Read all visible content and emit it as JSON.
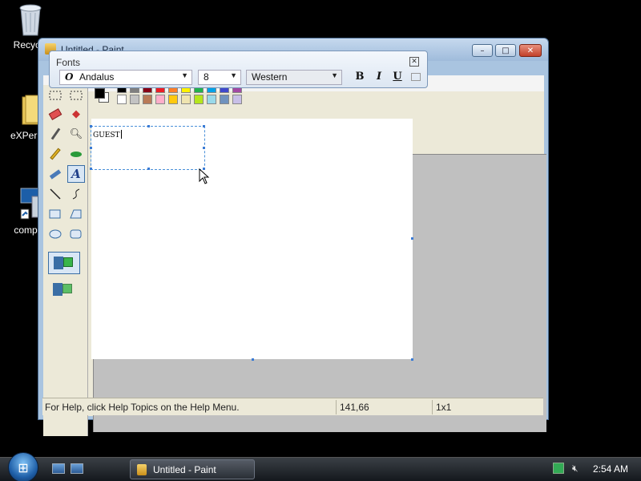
{
  "desktop": {
    "icons": [
      {
        "label": "Recycle",
        "icon": "recycle-bin-icon"
      },
      {
        "label": "eXPeric",
        "icon": "folder-icon"
      },
      {
        "label": "comp",
        "icon": "computer-icon"
      }
    ]
  },
  "window": {
    "title": "Untitled - Paint",
    "controls": {
      "minimize": "–",
      "maximize": "□",
      "close": "✕"
    }
  },
  "fonts_toolbar": {
    "caption": "Fonts",
    "close_glyph": "✕",
    "font_name": "Andalus",
    "font_glyph": "O",
    "font_size": "8",
    "script": "Western",
    "bold": "B",
    "italic": "I",
    "underline": "U"
  },
  "canvas": {
    "text": "GUEST"
  },
  "palette": {
    "top_row": [
      "#000000",
      "#7f7f7f",
      "#880015",
      "#ed1c24",
      "#ff7f27",
      "#fff200",
      "#22b14c",
      "#00a2e8",
      "#3f48cc",
      "#a349a4"
    ],
    "bottom_row": [
      "#ffffff",
      "#c3c3c3",
      "#b97a57",
      "#ffaec9",
      "#ffc90e",
      "#efe4b0",
      "#b5e61d",
      "#99d9ea",
      "#7092be",
      "#c8bfe7"
    ],
    "primary": "#000000",
    "secondary": "#ffffff"
  },
  "statusbar": {
    "help": "For Help, click Help Topics on the Help Menu.",
    "coords": "141,66",
    "size": "1x1"
  },
  "taskbar": {
    "start_glyph": "⊞",
    "task_label": "Untitled - Paint",
    "clock": "2:54 AM"
  }
}
